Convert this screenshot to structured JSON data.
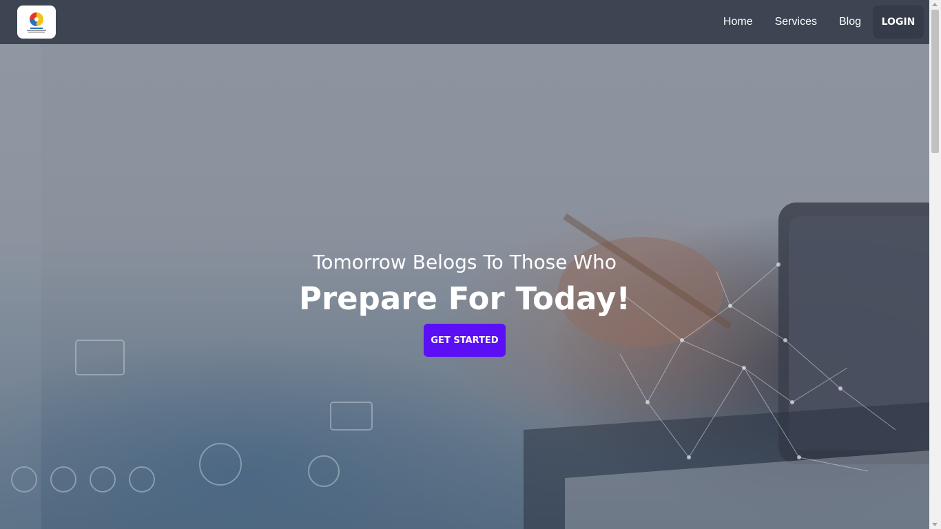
{
  "nav": {
    "home": "Home",
    "services": "Services",
    "blog": "Blog",
    "login": "LOGIN"
  },
  "hero": {
    "subtitle": "Tomorrow Belogs To Those Who",
    "title": "Prepare For Today!",
    "cta": "GET STARTED"
  },
  "colors": {
    "navbar": "#3d4452",
    "cta": "#5b0ff5"
  },
  "icons": {
    "logo": "company-logo"
  }
}
